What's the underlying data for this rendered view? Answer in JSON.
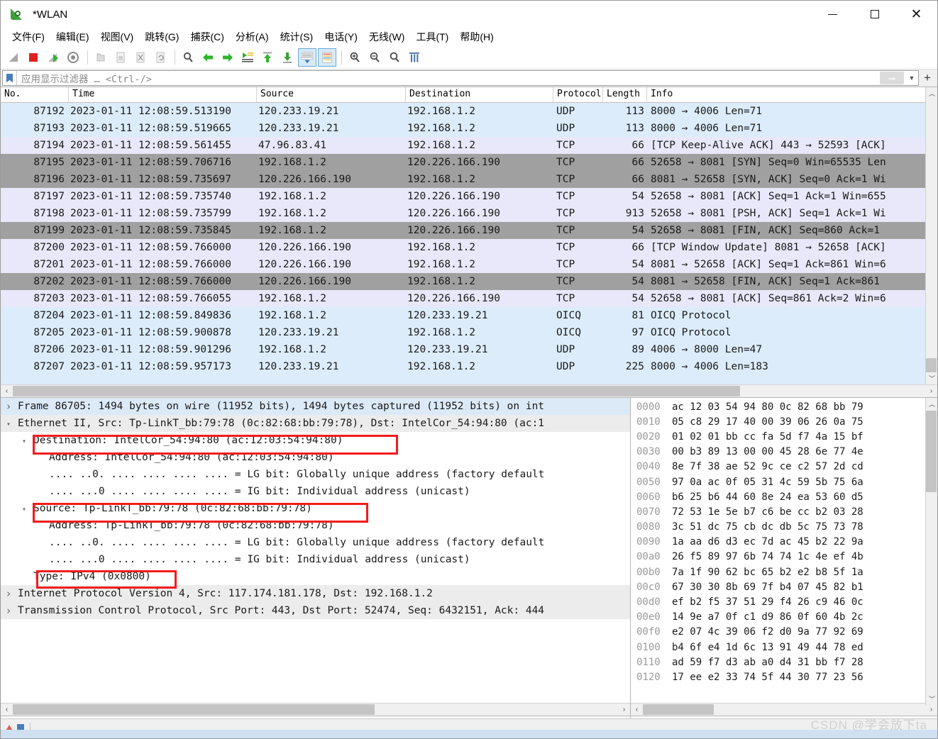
{
  "window": {
    "title": "*WLAN",
    "logo_icon": "wireshark-fin-icon",
    "minimize_label": "Minimize",
    "maximize_label": "Maximize",
    "close_label": "Close"
  },
  "menu": {
    "items": [
      "文件(F)",
      "编辑(E)",
      "视图(V)",
      "跳转(G)",
      "捕获(C)",
      "分析(A)",
      "统计(S)",
      "电话(Y)",
      "无线(W)",
      "工具(T)",
      "帮助(H)"
    ]
  },
  "toolbar": {
    "buttons": [
      "start-capture-icon",
      "stop-capture-icon",
      "restart-capture-icon",
      "capture-options-icon",
      "open-file-icon",
      "save-file-icon",
      "close-file-icon",
      "reload-file-icon",
      "find-packet-icon",
      "go-back-icon",
      "go-forward-icon",
      "go-to-packet-icon",
      "go-first-packet-icon",
      "go-last-packet-icon",
      "autoscroll-icon",
      "colorize-icon",
      "zoom-in-icon",
      "zoom-out-icon",
      "zoom-reset-icon",
      "resize-columns-icon"
    ]
  },
  "filter": {
    "bookmark_icon": "bookmark-icon",
    "placeholder": "应用显示过滤器 … <Ctrl-/>",
    "value": "",
    "apply_icon": "apply-filter-arrow-icon",
    "dropdown_icon": "chevron-down-icon",
    "add_icon": "plus-icon"
  },
  "packet_list": {
    "columns": [
      "No.",
      "Time",
      "Source",
      "Destination",
      "Protocol",
      "Length",
      "Info"
    ],
    "rows": [
      {
        "no": "87192",
        "time": "2023-01-11 12:08:59.513190",
        "src": "120.233.19.21",
        "dst": "192.168.1.2",
        "proto": "UDP",
        "len": "113",
        "info": "8000 → 4006 Len=71",
        "style": "bg-udp"
      },
      {
        "no": "87193",
        "time": "2023-01-11 12:08:59.519665",
        "src": "120.233.19.21",
        "dst": "192.168.1.2",
        "proto": "UDP",
        "len": "113",
        "info": "8000 → 4006 Len=71",
        "style": "bg-udp"
      },
      {
        "no": "87194",
        "time": "2023-01-11 12:08:59.561455",
        "src": "47.96.83.41",
        "dst": "192.168.1.2",
        "proto": "TCP",
        "len": "66",
        "info": "[TCP Keep-Alive ACK] 443 → 52593 [ACK]",
        "style": "bg-tcp1"
      },
      {
        "no": "87195",
        "time": "2023-01-11 12:08:59.706716",
        "src": "192.168.1.2",
        "dst": "120.226.166.190",
        "proto": "TCP",
        "len": "66",
        "info": "52658 → 8081 [SYN] Seq=0 Win=65535 Len",
        "style": "bg-tcp2"
      },
      {
        "no": "87196",
        "time": "2023-01-11 12:08:59.735697",
        "src": "120.226.166.190",
        "dst": "192.168.1.2",
        "proto": "TCP",
        "len": "66",
        "info": "8081 → 52658 [SYN, ACK] Seq=0 Ack=1 Wi",
        "style": "bg-tcp2"
      },
      {
        "no": "87197",
        "time": "2023-01-11 12:08:59.735740",
        "src": "192.168.1.2",
        "dst": "120.226.166.190",
        "proto": "TCP",
        "len": "54",
        "info": "52658 → 8081 [ACK] Seq=1 Ack=1 Win=655",
        "style": "bg-tcp1"
      },
      {
        "no": "87198",
        "time": "2023-01-11 12:08:59.735799",
        "src": "192.168.1.2",
        "dst": "120.226.166.190",
        "proto": "TCP",
        "len": "913",
        "info": "52658 → 8081 [PSH, ACK] Seq=1 Ack=1 Wi",
        "style": "bg-tcp1"
      },
      {
        "no": "87199",
        "time": "2023-01-11 12:08:59.735845",
        "src": "192.168.1.2",
        "dst": "120.226.166.190",
        "proto": "TCP",
        "len": "54",
        "info": "52658 → 8081 [FIN, ACK] Seq=860 Ack=1",
        "style": "bg-tcp2"
      },
      {
        "no": "87200",
        "time": "2023-01-11 12:08:59.766000",
        "src": "120.226.166.190",
        "dst": "192.168.1.2",
        "proto": "TCP",
        "len": "66",
        "info": "[TCP Window Update] 8081 → 52658 [ACK]",
        "style": "bg-tcp1"
      },
      {
        "no": "87201",
        "time": "2023-01-11 12:08:59.766000",
        "src": "120.226.166.190",
        "dst": "192.168.1.2",
        "proto": "TCP",
        "len": "54",
        "info": "8081 → 52658 [ACK] Seq=1 Ack=861 Win=6",
        "style": "bg-tcp1"
      },
      {
        "no": "87202",
        "time": "2023-01-11 12:08:59.766000",
        "src": "120.226.166.190",
        "dst": "192.168.1.2",
        "proto": "TCP",
        "len": "54",
        "info": "8081 → 52658 [FIN, ACK] Seq=1 Ack=861",
        "style": "bg-tcp2"
      },
      {
        "no": "87203",
        "time": "2023-01-11 12:08:59.766055",
        "src": "192.168.1.2",
        "dst": "120.226.166.190",
        "proto": "TCP",
        "len": "54",
        "info": "52658 → 8081 [ACK] Seq=861 Ack=2 Win=6",
        "style": "bg-tcp1"
      },
      {
        "no": "87204",
        "time": "2023-01-11 12:08:59.849836",
        "src": "192.168.1.2",
        "dst": "120.233.19.21",
        "proto": "OICQ",
        "len": "81",
        "info": "OICQ Protocol",
        "style": "bg-udp"
      },
      {
        "no": "87205",
        "time": "2023-01-11 12:08:59.900878",
        "src": "120.233.19.21",
        "dst": "192.168.1.2",
        "proto": "OICQ",
        "len": "97",
        "info": "OICQ Protocol",
        "style": "bg-udp"
      },
      {
        "no": "87206",
        "time": "2023-01-11 12:08:59.901296",
        "src": "192.168.1.2",
        "dst": "120.233.19.21",
        "proto": "UDP",
        "len": "89",
        "info": "4006 → 8000 Len=47",
        "style": "bg-udp"
      },
      {
        "no": "87207",
        "time": "2023-01-11 12:08:59.957173",
        "src": "120.233.19.21",
        "dst": "192.168.1.2",
        "proto": "UDP",
        "len": "225",
        "info": "8000 → 4006 Len=183",
        "style": "bg-udp"
      }
    ]
  },
  "packet_details": {
    "lines": [
      {
        "text": "Frame 86705: 1494 bytes on wire (11952 bits), 1494 bytes captured (11952 bits) on int",
        "twisty": "closed",
        "indent": 0,
        "style": "hl-frame"
      },
      {
        "text": "Ethernet II, Src: Tp-LinkT_bb:79:78 (0c:82:68:bb:79:78), Dst: IntelCor_54:94:80 (ac:1",
        "twisty": "open",
        "indent": 0,
        "style": "greyrow"
      },
      {
        "text": "Destination: IntelCor_54:94:80 (ac:12:03:54:94:80)",
        "twisty": "open",
        "indent": 1,
        "style": ""
      },
      {
        "text": "Address: IntelCor_54:94:80 (ac:12:03:54:94:80)",
        "twisty": "none",
        "indent": 2,
        "style": ""
      },
      {
        "text": ".... ..0. .... .... .... .... = LG bit: Globally unique address (factory default",
        "twisty": "none",
        "indent": 2,
        "style": ""
      },
      {
        "text": ".... ...0 .... .... .... .... = IG bit: Individual address (unicast)",
        "twisty": "none",
        "indent": 2,
        "style": ""
      },
      {
        "text": "Source: Tp-LinkT_bb:79:78 (0c:82:68:bb:79:78)",
        "twisty": "open",
        "indent": 1,
        "style": ""
      },
      {
        "text": "Address: Tp-LinkT_bb:79:78 (0c:82:68:bb:79:78)",
        "twisty": "none",
        "indent": 2,
        "style": ""
      },
      {
        "text": ".... ..0. .... .... .... .... = LG bit: Globally unique address (factory default",
        "twisty": "none",
        "indent": 2,
        "style": ""
      },
      {
        "text": ".... ...0 .... .... .... .... = IG bit: Individual address (unicast)",
        "twisty": "none",
        "indent": 2,
        "style": ""
      },
      {
        "text": "Type: IPv4 (0x0800)",
        "twisty": "none",
        "indent": 1,
        "style": ""
      },
      {
        "text": "Internet Protocol Version 4, Src: 117.174.181.178, Dst: 192.168.1.2",
        "twisty": "closed",
        "indent": 0,
        "style": "greyrow"
      },
      {
        "text": "Transmission Control Protocol, Src Port: 443, Dst Port: 52474, Seq: 6432151, Ack: 444",
        "twisty": "closed",
        "indent": 0,
        "style": "greyrow"
      }
    ],
    "highlight_boxes": [
      {
        "name": "destination-highlight",
        "line": 2
      },
      {
        "name": "source-highlight",
        "line": 6
      },
      {
        "name": "type-highlight",
        "line": 10
      }
    ]
  },
  "hex_dump": {
    "rows": [
      {
        "offset": "0000",
        "bytes": "ac 12 03 54 94 80 0c 82  68 bb 79"
      },
      {
        "offset": "0010",
        "bytes": "05 c8 29 17 40 00 39 06  26 0a 75"
      },
      {
        "offset": "0020",
        "bytes": "01 02 01 bb cc fa 5d f7  4a 15 bf"
      },
      {
        "offset": "0030",
        "bytes": "00 b3 89 13 00 00 45 28  6e 77 4e"
      },
      {
        "offset": "0040",
        "bytes": "8e 7f 38 ae 52 9c ce c2  57 2d cd"
      },
      {
        "offset": "0050",
        "bytes": "97 0a ac 0f 05 31 4c 59  5b 75 6a"
      },
      {
        "offset": "0060",
        "bytes": "b6 25 b6 44 60 8e 24 ea  53 60 d5"
      },
      {
        "offset": "0070",
        "bytes": "72 53 1e 5e b7 c6 be cc  b2 03 28"
      },
      {
        "offset": "0080",
        "bytes": "3c 51 dc 75 cb dc db 5c  75 73 78"
      },
      {
        "offset": "0090",
        "bytes": "1a aa d6 d3 ec 7d ac 45  b2 22 9a"
      },
      {
        "offset": "00a0",
        "bytes": "26 f5 89 97 6b 74 74 1c  4e ef 4b"
      },
      {
        "offset": "00b0",
        "bytes": "7a 1f 90 62 bc 65 b2 e2  b8 5f 1a"
      },
      {
        "offset": "00c0",
        "bytes": "67 30 30 8b 69 7f b4 07  45 82 b1"
      },
      {
        "offset": "00d0",
        "bytes": "ef b2 f5 37 51 29 f4 26  c9 46 0c"
      },
      {
        "offset": "00e0",
        "bytes": "14 9e a7 0f c1 d9 86 0f  60 4b 2c"
      },
      {
        "offset": "00f0",
        "bytes": "e2 07 4c 39 06 f2 d0 9a  77 92 69"
      },
      {
        "offset": "0100",
        "bytes": "b4 6f e4 1d 6c 13 91 49  44 78 ed"
      },
      {
        "offset": "0110",
        "bytes": "ad 59 f7 d3 ab a0 d4 31  bb f7 28"
      },
      {
        "offset": "0120",
        "bytes": "17 ee e2 33 74 5f 44 30  77 23 56"
      }
    ]
  },
  "watermark": {
    "text": "CSDN @学会放下ta"
  },
  "colors": {
    "udp_row": "#dcecfa",
    "tcp_row": "#e8e8fa",
    "tcp_dark_row": "#a0a0a0",
    "highlight_box": "#f41b1b",
    "selected_detail": "#dce9f7"
  }
}
